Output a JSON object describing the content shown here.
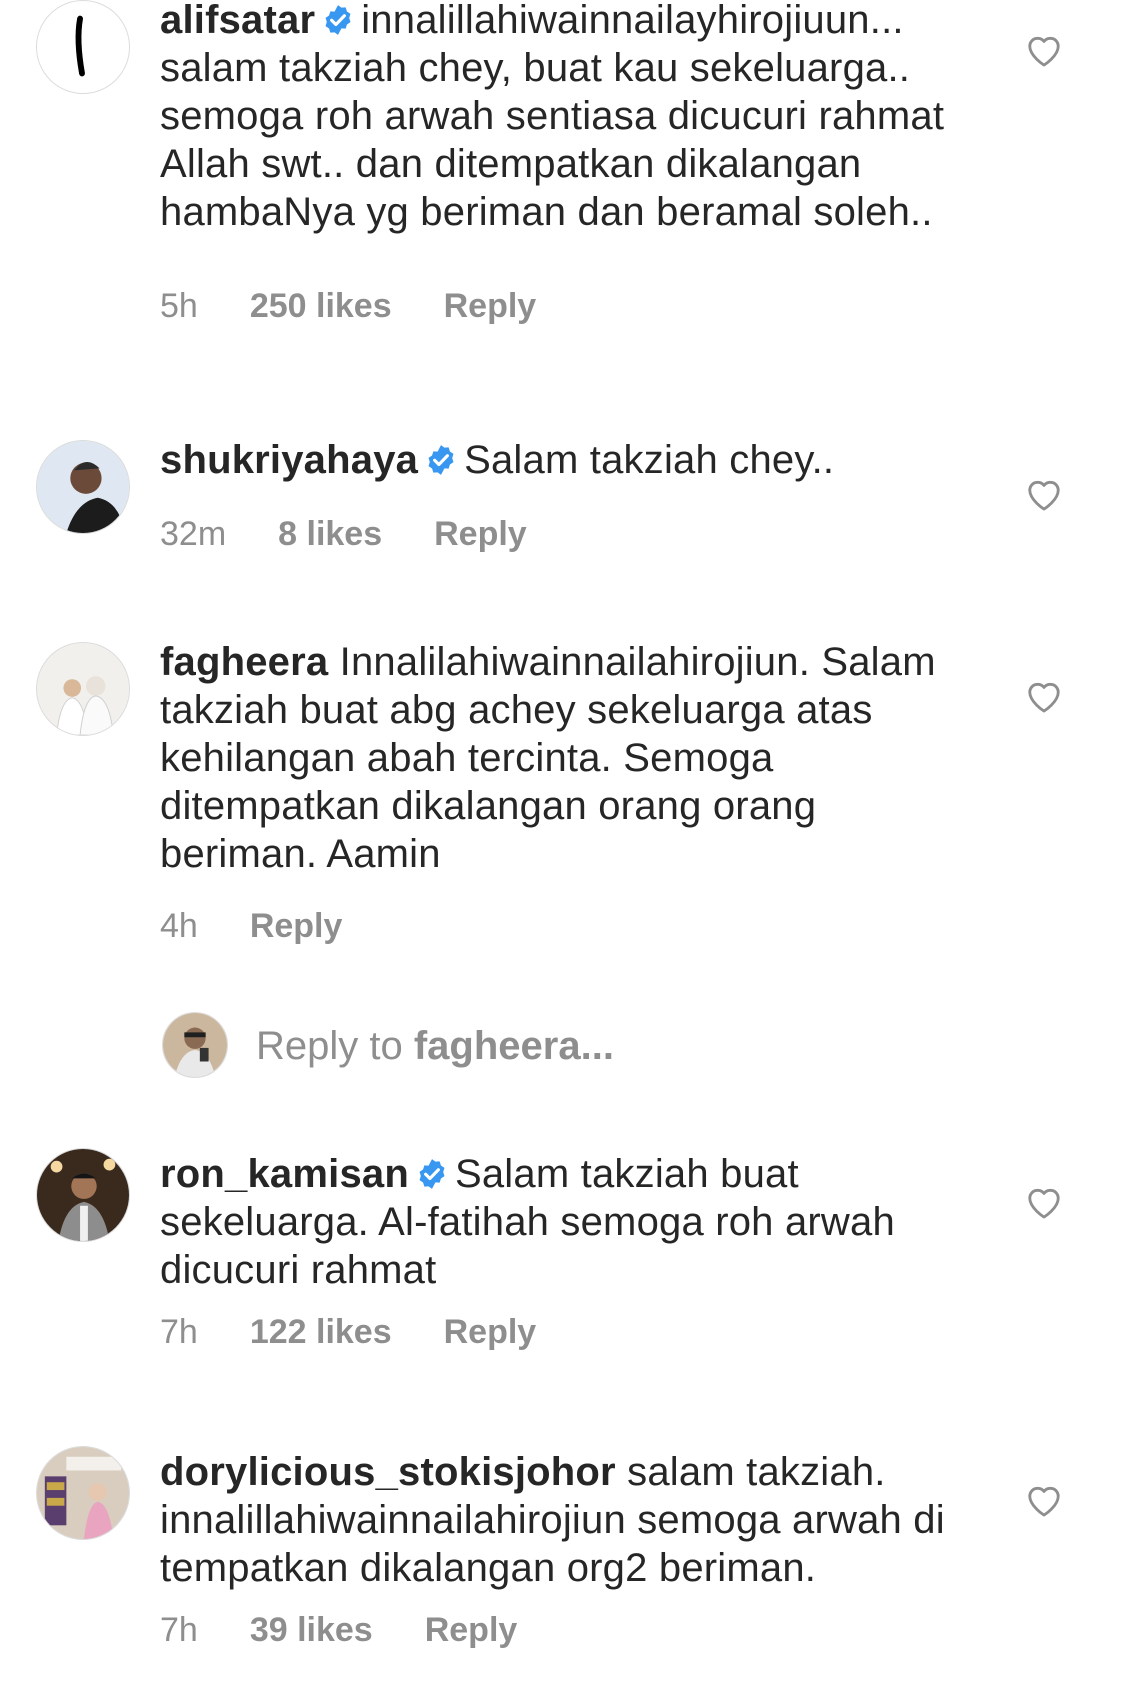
{
  "comments": [
    {
      "username": "alifsatar",
      "verified": true,
      "text": "innalillahiwainnailayhirojiuun... salam takziah chey, buat kau sekeluarga.. semoga roh arwah sentiasa dicucuri rahmat Allah swt.. dan ditempatkan dikalangan hambaNya yg beriman dan beramal soleh..",
      "time": "5h",
      "likes": "250 likes",
      "reply": "Reply"
    },
    {
      "username": "shukriyahaya",
      "verified": true,
      "text": "Salam takziah chey..",
      "time": "32m",
      "likes": "8 likes",
      "reply": "Reply"
    },
    {
      "username": "fagheera",
      "verified": false,
      "text": "Innalilahiwainnailahirojiun. Salam takziah buat abg achey sekeluarga atas kehilangan abah tercinta. Semoga ditempatkan dikalangan orang orang beriman. Aamin",
      "time": "4h",
      "likes": "",
      "reply": "Reply"
    },
    {
      "username": "ron_kamisan",
      "verified": true,
      "text": "Salam takziah buat sekeluarga. Al-fatihah semoga roh arwah dicucuri rahmat",
      "time": "7h",
      "likes": "122 likes",
      "reply": "Reply"
    },
    {
      "username": "dorylicious_stokisjohor",
      "verified": false,
      "text": "salam takziah. innalillahiwainnailahirojiun semoga arwah di tempatkan dikalangan org2 beriman.",
      "time": "7h",
      "likes": "39 likes",
      "reply": "Reply"
    }
  ],
  "reply_box": {
    "prefix": "Reply to ",
    "target": "fagheera..."
  },
  "colors": {
    "text": "#262626",
    "muted": "#8e8e8e",
    "verified": "#3897f0"
  },
  "icons": {
    "like": "heart-outline-icon",
    "verified": "verified-badge-icon"
  }
}
